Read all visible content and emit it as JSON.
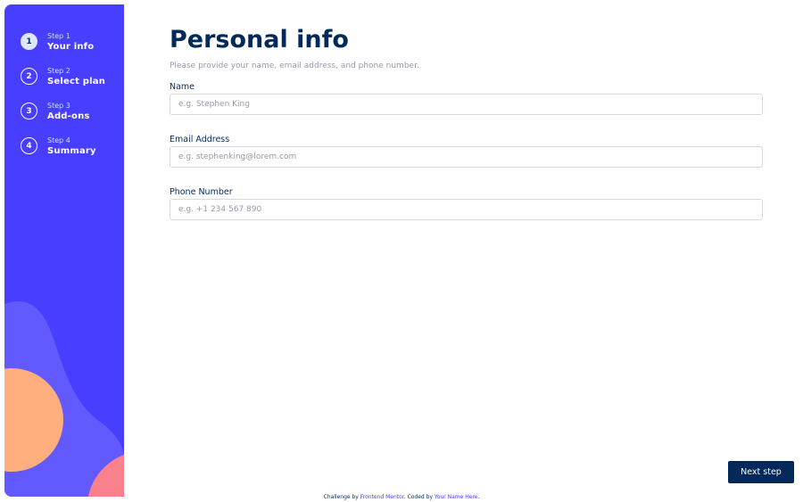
{
  "sidebar": {
    "steps": [
      {
        "number": "1",
        "label": "Step 1",
        "title": "Your info",
        "active": true
      },
      {
        "number": "2",
        "label": "Step 2",
        "title": "Select plan",
        "active": false
      },
      {
        "number": "3",
        "label": "Step 3",
        "title": "Add-ons",
        "active": false
      },
      {
        "number": "4",
        "label": "Step 4",
        "title": "Summary",
        "active": false
      }
    ]
  },
  "form": {
    "title": "Personal info",
    "subtitle": "Please provide your name, email address, and phone number.",
    "fields": [
      {
        "label": "Name",
        "placeholder": "e.g. Stephen King",
        "value": ""
      },
      {
        "label": "Email Address",
        "placeholder": "e.g. stephenking@lorem.com",
        "value": ""
      },
      {
        "label": "Phone Number",
        "placeholder": "e.g. +1 234 567 890",
        "value": ""
      }
    ],
    "next_label": "Next step"
  },
  "attribution": {
    "prefix": "Challenge by ",
    "link1": "Frontend Mentor",
    "middle": ". Coded by ",
    "link2": "Your Name Here",
    "suffix": "."
  },
  "colors": {
    "sidebar": "#483eff",
    "primary_text": "#02295a",
    "muted_text": "#9699ab",
    "active_step": "#dfe6ff",
    "button": "#02295a",
    "blob_light": "#6259ff",
    "blob_orange": "#ffaf7e",
    "blob_pink": "#f9818e"
  }
}
